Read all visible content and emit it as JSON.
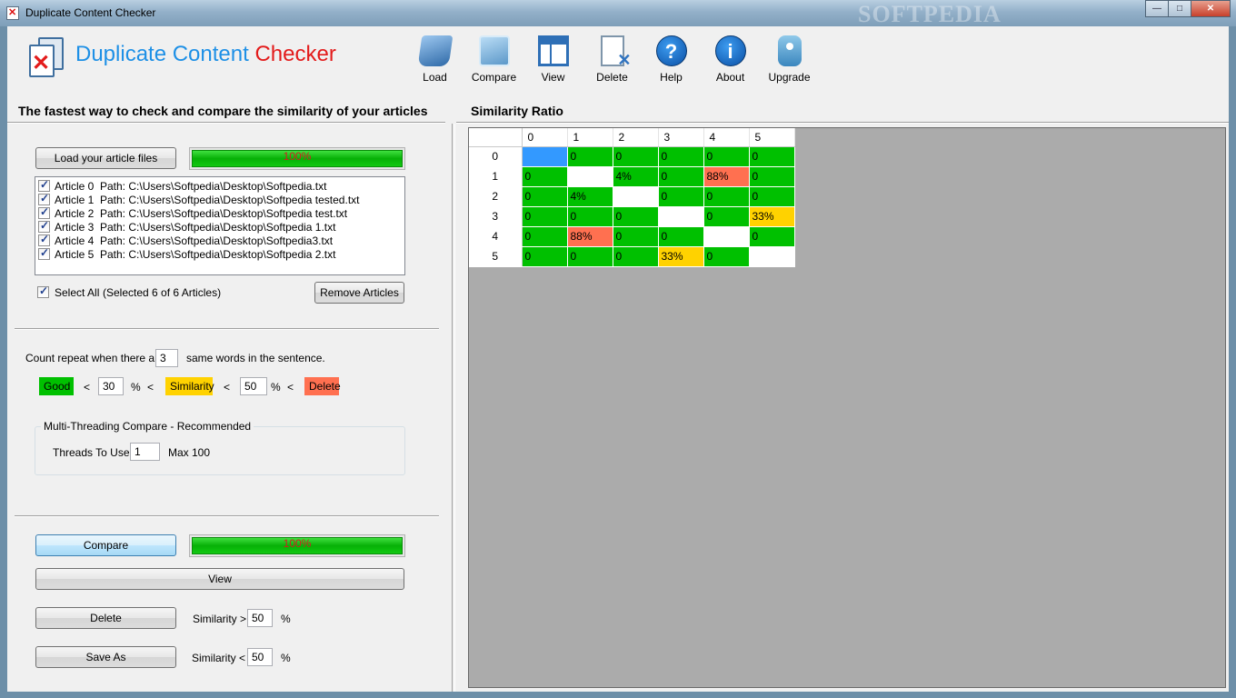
{
  "window": {
    "title": "Duplicate Content Checker",
    "watermark": "SOFTPEDIA"
  },
  "header": {
    "logo_part1": "Duplicate Content",
    "logo_part2": "Checker",
    "logo_colors": {
      "part1": "#1e90e6",
      "part2": "#e31b1b"
    }
  },
  "toolbar": [
    {
      "label": "Load",
      "icon": "load-icon"
    },
    {
      "label": "Compare",
      "icon": "compare-icon"
    },
    {
      "label": "View",
      "icon": "view-icon"
    },
    {
      "label": "Delete",
      "icon": "delete-icon"
    },
    {
      "label": "Help",
      "icon": "help-icon",
      "glyph": "?"
    },
    {
      "label": "About",
      "icon": "about-icon",
      "glyph": "i"
    },
    {
      "label": "Upgrade",
      "icon": "upgrade-icon"
    }
  ],
  "left": {
    "tagline": "The fastest way to check and compare the similarity of your articles",
    "load_button": "Load your article files",
    "load_progress": {
      "text": "100%",
      "value": 1.0
    },
    "articles": [
      {
        "name": "Article 0",
        "path": "Path: C:\\Users\\Softpedia\\Desktop\\Softpedia.txt",
        "checked": true
      },
      {
        "name": "Article 1",
        "path": "Path: C:\\Users\\Softpedia\\Desktop\\Softpedia tested.txt",
        "checked": true
      },
      {
        "name": "Article 2",
        "path": "Path: C:\\Users\\Softpedia\\Desktop\\Softpedia test.txt",
        "checked": true
      },
      {
        "name": "Article 3",
        "path": "Path: C:\\Users\\Softpedia\\Desktop\\Softpedia 1.txt",
        "checked": true
      },
      {
        "name": "Article 4",
        "path": "Path: C:\\Users\\Softpedia\\Desktop\\Softpedia3.txt",
        "checked": true
      },
      {
        "name": "Article 5",
        "path": "Path: C:\\Users\\Softpedia\\Desktop\\Softpedia 2.txt",
        "checked": true
      }
    ],
    "select_all_label": "Select All",
    "selection_status": "(Selected 6 of 6 Articles)",
    "remove_button": "Remove Articles",
    "count_prefix": "Count repeat when there are",
    "count_value": "3",
    "count_suffix": "same words in the sentence.",
    "good_label": "Good",
    "good_threshold": "30",
    "similarity_label": "Similarity",
    "similarity_threshold": "50",
    "delete_label": "Delete",
    "lt": "<",
    "pct": "%",
    "threading_title": "Multi-Threading Compare - Recommended",
    "threads_label": "Threads To Use",
    "threads_value": "1",
    "threads_max": "Max 100",
    "compare_button": "Compare",
    "compare_progress": {
      "text": "100%",
      "value": 1.0
    },
    "view_button": "View",
    "delete_button": "Delete",
    "delete_sim_label": "Similarity >",
    "delete_sim_value": "50",
    "saveas_button": "Save As",
    "saveas_sim_label": "Similarity <",
    "saveas_sim_value": "50"
  },
  "colors": {
    "good": "#00c000",
    "similarity": "#ffd200",
    "delete": "#ff7050",
    "self": "#3399ff",
    "empty": "#ffffff"
  },
  "similarity": {
    "title": "Similarity Ratio",
    "columns": [
      "0",
      "1",
      "2",
      "3",
      "4",
      "5"
    ],
    "rows": [
      {
        "label": "0",
        "cells": [
          {
            "text": "",
            "status": "self"
          },
          {
            "text": "0",
            "status": "good"
          },
          {
            "text": "0",
            "status": "good"
          },
          {
            "text": "0",
            "status": "good"
          },
          {
            "text": "0",
            "status": "good"
          },
          {
            "text": "0",
            "status": "good"
          }
        ]
      },
      {
        "label": "1",
        "cells": [
          {
            "text": "0",
            "status": "good"
          },
          {
            "text": "",
            "status": "empty"
          },
          {
            "text": "4%",
            "status": "good"
          },
          {
            "text": "0",
            "status": "good"
          },
          {
            "text": "88%",
            "status": "delete"
          },
          {
            "text": "0",
            "status": "good"
          }
        ]
      },
      {
        "label": "2",
        "cells": [
          {
            "text": "0",
            "status": "good"
          },
          {
            "text": "4%",
            "status": "good"
          },
          {
            "text": "",
            "status": "empty"
          },
          {
            "text": "0",
            "status": "good"
          },
          {
            "text": "0",
            "status": "good"
          },
          {
            "text": "0",
            "status": "good"
          }
        ]
      },
      {
        "label": "3",
        "cells": [
          {
            "text": "0",
            "status": "good"
          },
          {
            "text": "0",
            "status": "good"
          },
          {
            "text": "0",
            "status": "good"
          },
          {
            "text": "",
            "status": "empty"
          },
          {
            "text": "0",
            "status": "good"
          },
          {
            "text": "33%",
            "status": "similarity"
          }
        ]
      },
      {
        "label": "4",
        "cells": [
          {
            "text": "0",
            "status": "good"
          },
          {
            "text": "88%",
            "status": "delete"
          },
          {
            "text": "0",
            "status": "good"
          },
          {
            "text": "0",
            "status": "good"
          },
          {
            "text": "",
            "status": "empty"
          },
          {
            "text": "0",
            "status": "good"
          }
        ]
      },
      {
        "label": "5",
        "cells": [
          {
            "text": "0",
            "status": "good"
          },
          {
            "text": "0",
            "status": "good"
          },
          {
            "text": "0",
            "status": "good"
          },
          {
            "text": "33%",
            "status": "similarity"
          },
          {
            "text": "0",
            "status": "good"
          },
          {
            "text": "",
            "status": "empty"
          }
        ]
      }
    ]
  }
}
